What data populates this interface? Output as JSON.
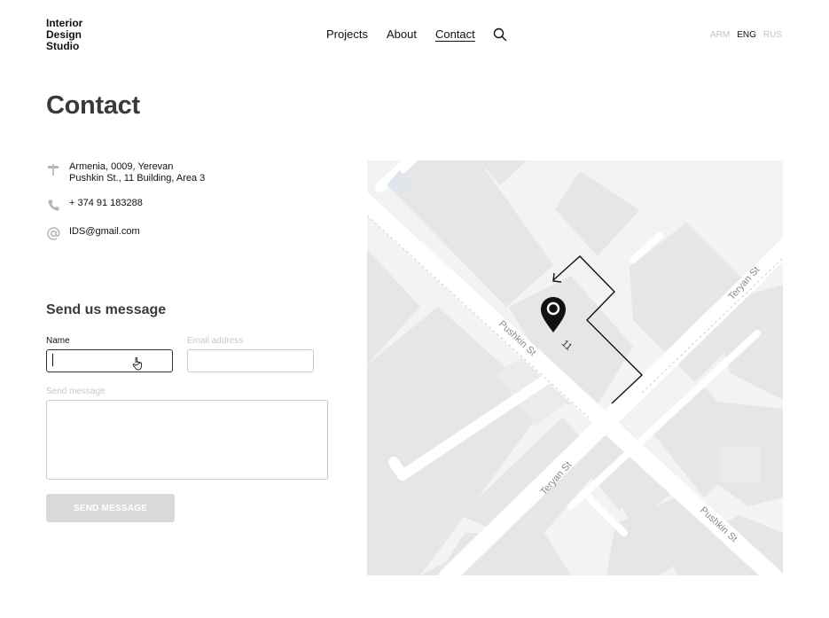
{
  "logo": {
    "lines": [
      "Interior",
      "Design",
      "Studio"
    ]
  },
  "nav": {
    "projects": "Projects",
    "about": "About",
    "contact": "Contact"
  },
  "languages": [
    {
      "code": "ARM",
      "active": false
    },
    {
      "code": "ENG",
      "active": true
    },
    {
      "code": "RUS",
      "active": false
    }
  ],
  "page_title": "Contact",
  "contact": {
    "address_line1": "Armenia, 0009, Yerevan",
    "address_line2": "Pushkin St., 11 Building, Area 3",
    "phone": "+ 374 91 183288",
    "email": "IDS@gmail.com"
  },
  "form": {
    "title": "Send us  message",
    "name_label": "Name",
    "email_label": "Email address",
    "message_label": "Send message",
    "name_value": "",
    "email_value": "",
    "message_value": "",
    "submit_label": "SEND MESSAGE"
  },
  "map": {
    "streets": [
      "Pushkin St",
      "Teryan St",
      "Teryan St",
      "Pushkin St"
    ],
    "building_number": "11"
  },
  "icons": {
    "search": "search-icon",
    "address": "signpost-icon",
    "phone": "phone-icon",
    "email": "at-sign-icon",
    "pin": "map-pin-icon",
    "cursor": "hand-pointer-icon"
  },
  "colors": {
    "text": "#111111",
    "heading": "#3a3a3a",
    "muted": "#c4c4c4",
    "button": "#d9d9d9"
  }
}
